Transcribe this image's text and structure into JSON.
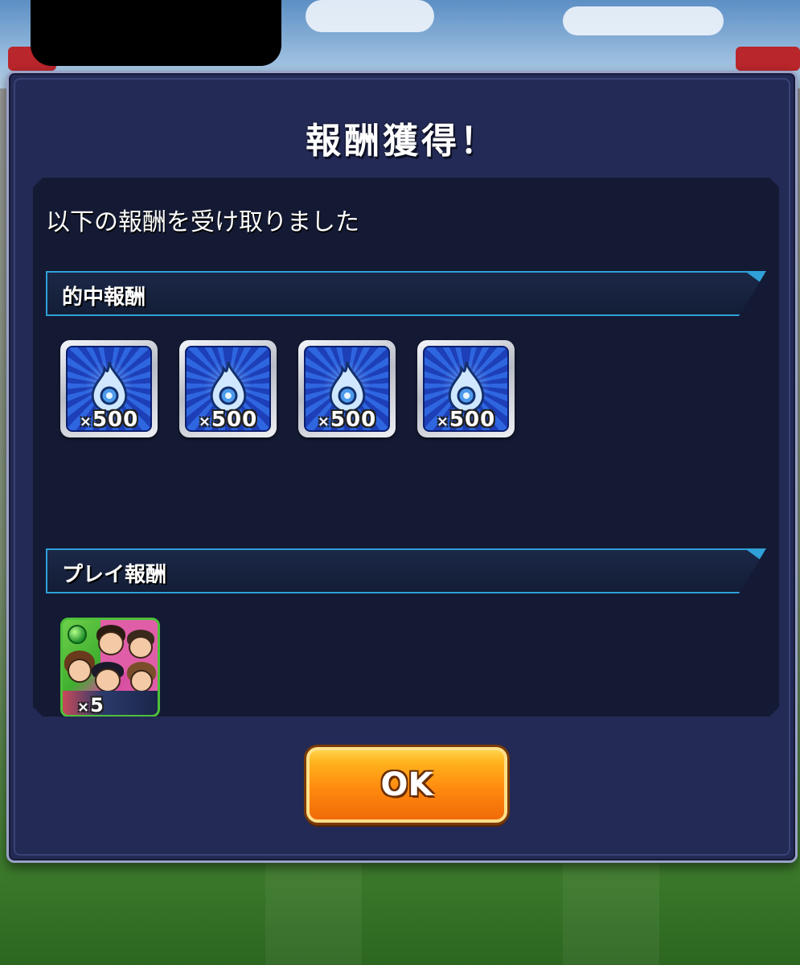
{
  "modal": {
    "title": "報酬獲得！",
    "subtitle": "以下の報酬を受け取りました"
  },
  "sections": [
    {
      "label": "的中報酬",
      "items": [
        {
          "icon": "blue-flame-icon",
          "quantity": "500"
        },
        {
          "icon": "blue-flame-icon",
          "quantity": "500"
        },
        {
          "icon": "blue-flame-icon",
          "quantity": "500"
        },
        {
          "icon": "blue-flame-icon",
          "quantity": "500"
        }
      ]
    },
    {
      "label": "プレイ報酬",
      "items": [
        {
          "icon": "character-group-icon",
          "quantity": "5"
        }
      ]
    }
  ],
  "quantity_prefix": "×",
  "ok_button": {
    "label": "OK"
  },
  "colors": {
    "modal_bg": "#232a55",
    "content_bg": "#141a33",
    "section_accent": "#2fa0d8",
    "button_orange": "#ff8a10"
  }
}
